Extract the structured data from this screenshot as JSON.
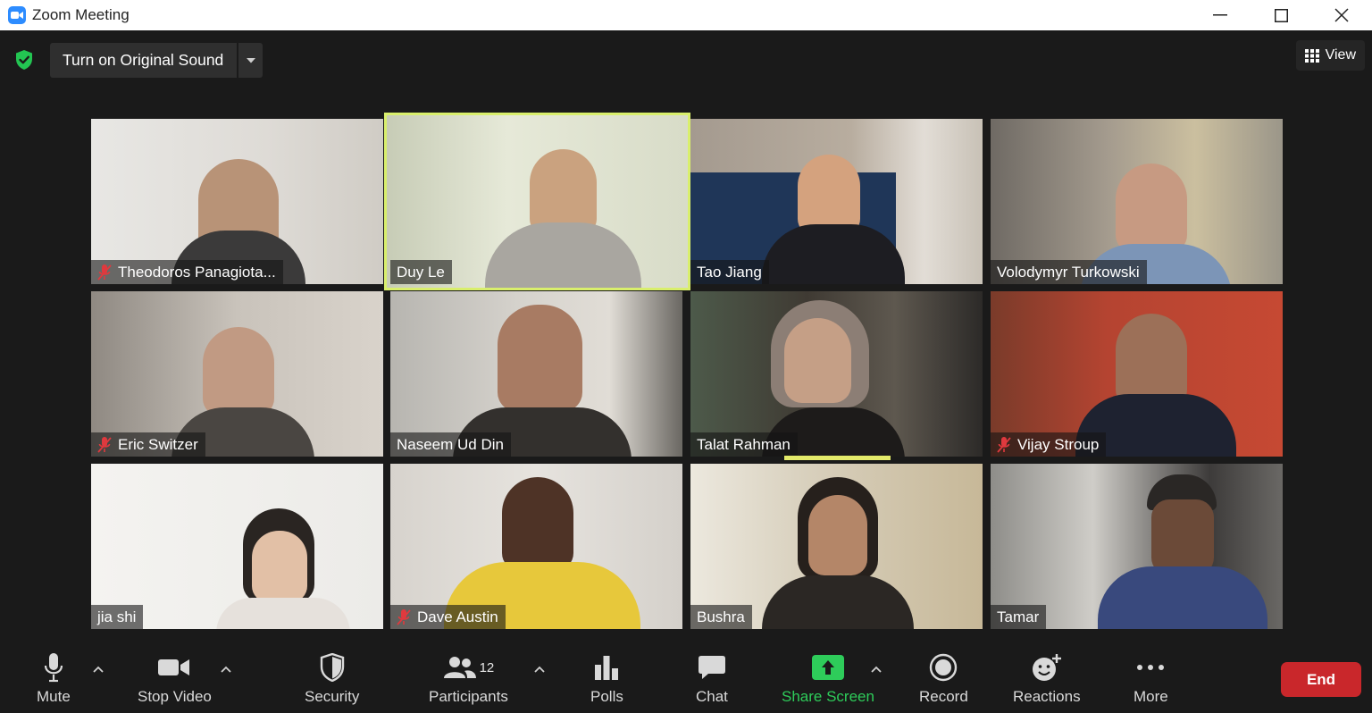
{
  "window": {
    "title": "Zoom Meeting"
  },
  "topbar": {
    "original_sound_label": "Turn on Original Sound",
    "view_label": "View"
  },
  "participants": [
    {
      "name": "Theodoros Panagiota...",
      "muted": true
    },
    {
      "name": "Duy Le",
      "muted": false,
      "active_speaker": true
    },
    {
      "name": "Tao Jiang",
      "muted": false
    },
    {
      "name": "Volodymyr Turkowski",
      "muted": false
    },
    {
      "name": "Eric Switzer",
      "muted": true
    },
    {
      "name": "Naseem Ud Din",
      "muted": false
    },
    {
      "name": "Talat Rahman",
      "muted": false
    },
    {
      "name": "Vijay Stroup",
      "muted": true
    },
    {
      "name": "jia shi",
      "muted": false
    },
    {
      "name": "Dave Austin",
      "muted": true
    },
    {
      "name": "Bushra",
      "muted": false
    },
    {
      "name": "Tamar",
      "muted": false
    }
  ],
  "toolbar": {
    "mute_label": "Mute",
    "stop_video_label": "Stop Video",
    "security_label": "Security",
    "participants_label": "Participants",
    "participants_count": "12",
    "polls_label": "Polls",
    "chat_label": "Chat",
    "share_screen_label": "Share Screen",
    "record_label": "Record",
    "reactions_label": "Reactions",
    "more_label": "More",
    "end_label": "End"
  },
  "colors": {
    "accent_blue": "#2d8cff",
    "share_green": "#2ecc5a",
    "end_red": "#c9272b",
    "active_speaker": "#d9ef6c",
    "mute_red": "#e0393e"
  }
}
